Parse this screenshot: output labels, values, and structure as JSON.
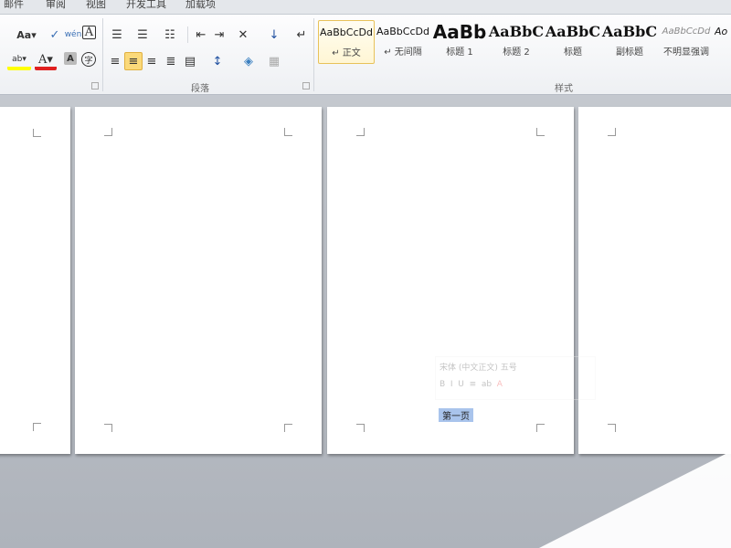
{
  "tabs": [
    "邮件",
    "审阅",
    "视图",
    "开发工具",
    "加载项"
  ],
  "font_group": {
    "change_case": "Aa▾",
    "phonetic": "wén",
    "char_border": "A",
    "highlight": "ab▾",
    "font_color": "A▾",
    "char_shading": "A",
    "enclose": "字"
  },
  "paragraph_group": {
    "label": "段落"
  },
  "styles_group": {
    "label": "样式",
    "items": [
      {
        "preview": "AaBbCcDd",
        "name": "↵ 正文",
        "selected": true
      },
      {
        "preview": "AaBbCcDd",
        "name": "↵ 无间隔"
      },
      {
        "preview": "AaBb",
        "name": "标题 1"
      },
      {
        "preview": "AaBbC",
        "name": "标题 2"
      },
      {
        "preview": "AaBbC",
        "name": "标题"
      },
      {
        "preview": "AaBbC",
        "name": "副标题"
      },
      {
        "preview": "AaBbCcDd",
        "name": "不明显强调"
      },
      {
        "preview": "Ao",
        "name": ""
      }
    ]
  },
  "mini_toolbar": {
    "font": "宋体 (中文正文)",
    "size": "五号"
  },
  "document": {
    "selected_text": "第一页"
  }
}
